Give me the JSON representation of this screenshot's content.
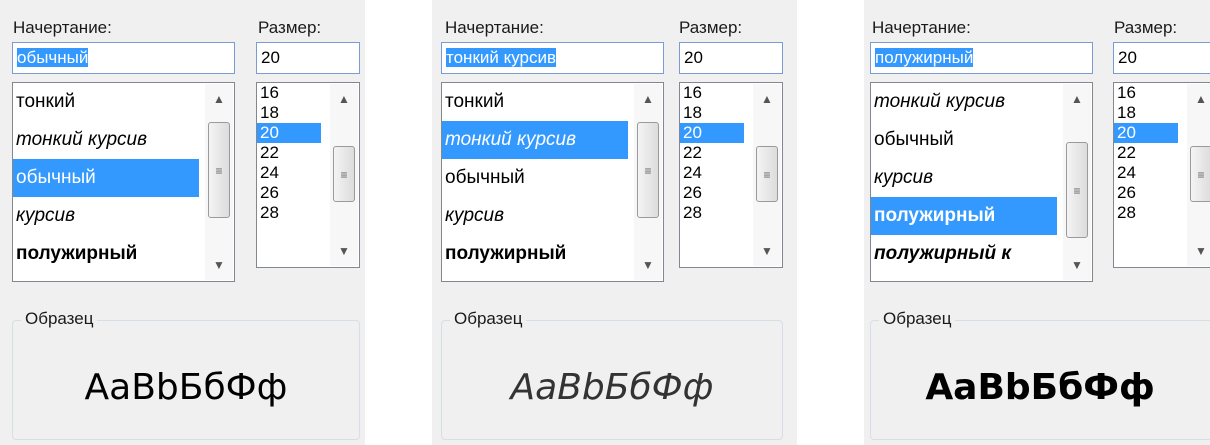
{
  "labels": {
    "style": "Начертание:",
    "size": "Размер:",
    "sample": "Образец"
  },
  "panels": [
    {
      "style_value": "обычный",
      "size_value": "20",
      "styles": [
        "тонкий",
        "тонкий курсив",
        "обычный",
        "курсив",
        "полужирный"
      ],
      "selected_style": "обычный",
      "sizes": [
        "16",
        "18",
        "20",
        "22",
        "24",
        "26",
        "28"
      ],
      "selected_size": "20",
      "sample": "AaBbБбФф"
    },
    {
      "style_value": "тонкий курсив",
      "size_value": "20",
      "styles": [
        "тонкий",
        "тонкий курсив",
        "обычный",
        "курсив",
        "полужирный"
      ],
      "selected_style": "тонкий курсив",
      "sizes": [
        "16",
        "18",
        "20",
        "22",
        "24",
        "26",
        "28"
      ],
      "selected_size": "20",
      "sample": "AaBbБбФф"
    },
    {
      "style_value": "полужирный",
      "size_value": "20",
      "styles": [
        "тонкий курсив",
        "обычный",
        "курсив",
        "полужирный",
        "полужирный к"
      ],
      "selected_style": "полужирный",
      "sizes": [
        "16",
        "18",
        "20",
        "22",
        "24",
        "26",
        "28"
      ],
      "selected_size": "20",
      "sample": "AaBbБбФф"
    }
  ],
  "icons": {
    "scroll_up": "scroll-up-arrow-icon",
    "scroll_down": "scroll-down-arrow-icon",
    "grip": "scroll-grip-icon"
  },
  "colors": {
    "selection": "#3399ff",
    "panel_bg": "#f0f0f0",
    "input_border": "#7a9bd3"
  }
}
